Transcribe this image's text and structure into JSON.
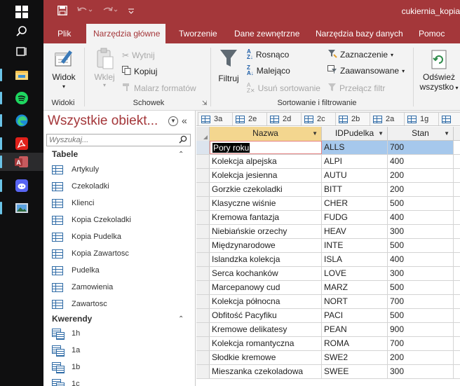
{
  "colors": {
    "accent": "#a4373a",
    "selected_row": "#a6c8ec"
  },
  "taskbar": {
    "icons": [
      "windows-icon",
      "search-icon",
      "task-view-icon",
      "file-explorer-icon",
      "spotify-icon",
      "edge-icon",
      "acrobat-icon",
      "access-icon",
      "discord-icon",
      "photos-icon"
    ]
  },
  "titlebar": {
    "document_title": "cukiernia_kopia"
  },
  "ribbon_tabs": [
    "Plik",
    "Narzędzia główne",
    "Tworzenie",
    "Dane zewnętrzne",
    "Narzędzia bazy danych",
    "Pomoc"
  ],
  "ribbon": {
    "widoki": {
      "label": "Widoki",
      "widok": "Widok"
    },
    "schowek": {
      "label": "Schowek",
      "wklej": "Wklej",
      "wytnij": "Wytnij",
      "kopiuj": "Kopiuj",
      "malarz": "Malarz formatów"
    },
    "sortowanie": {
      "label": "Sortowanie i filtrowanie",
      "filtruj": "Filtruj",
      "rosnaco": "Rosnąco",
      "malejaco": "Malejąco",
      "usun_sortowanie": "Usuń sortowanie",
      "zaznaczenie": "Zaznaczenie",
      "zaawansowane": "Zaawansowane",
      "przelacz_filtr": "Przełącz filtr"
    },
    "odswiez": {
      "line1": "Odśwież",
      "line2": "wszystko"
    }
  },
  "nav": {
    "title": "Wszystkie obiekt...",
    "search_placeholder": "Wyszukaj...",
    "tables_header": "Tabele",
    "tables": [
      "Artykuly",
      "Czekoladki",
      "Klienci",
      "Kopia Czekoladki",
      "Kopia Pudelka",
      "Kopia Zawartosc",
      "Pudelka",
      "Zamowienia",
      "Zawartosc"
    ],
    "queries_header": "Kwerendy",
    "queries": [
      "1h",
      "1a",
      "1b",
      "1c"
    ]
  },
  "object_tabs": [
    "3a",
    "2e",
    "2d",
    "2c",
    "2b",
    "2a",
    "1g",
    ""
  ],
  "grid": {
    "columns": [
      "Nazwa",
      "IDPudelka",
      "Stan"
    ],
    "rows": [
      [
        "Pory roku",
        "ALLS",
        "700"
      ],
      [
        "Kolekcja alpejska",
        "ALPI",
        "400"
      ],
      [
        "Kolekcja jesienna",
        "AUTU",
        "200"
      ],
      [
        "Gorzkie czekoladki",
        "BITT",
        "200"
      ],
      [
        "Klasyczne wiśnie",
        "CHER",
        "500"
      ],
      [
        "Kremowa fantazja",
        "FUDG",
        "400"
      ],
      [
        "Niebiańskie orzechy",
        "HEAV",
        "300"
      ],
      [
        "Międzynarodowe",
        "INTE",
        "500"
      ],
      [
        "Islandzka kolekcja",
        "ISLA",
        "400"
      ],
      [
        "Serca kochanków",
        "LOVE",
        "300"
      ],
      [
        "Marcepanowy cud",
        "MARZ",
        "500"
      ],
      [
        "Kolekcja północna",
        "NORT",
        "700"
      ],
      [
        "Obfitość Pacyfiku",
        "PACI",
        "500"
      ],
      [
        "Kremowe delikatesy",
        "PEAN",
        "900"
      ],
      [
        "Kolekcja romantyczna",
        "ROMA",
        "700"
      ],
      [
        "Słodkie kremowe",
        "SWE2",
        "200"
      ],
      [
        "Mieszanka czekoladowa",
        "SWEE",
        "300"
      ]
    ]
  }
}
